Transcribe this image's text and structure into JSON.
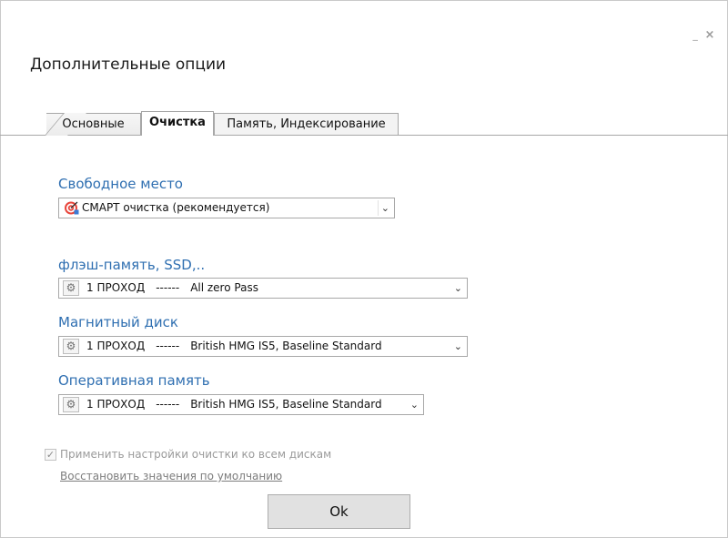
{
  "window": {
    "title": "Дополнительные опции",
    "minimize_glyph": "_",
    "close_glyph": "×"
  },
  "tabs": [
    {
      "label": "Основные",
      "active": false
    },
    {
      "label": "Очистка",
      "active": true
    },
    {
      "label": "Память, Индексирование",
      "active": false
    }
  ],
  "free_space": {
    "label": "Свободное место",
    "value": "СМАРТ очистка (рекомендуется)",
    "icon": "smart-target-icon"
  },
  "flash": {
    "label": "флэш-память, SSD,..",
    "passes": "1 ПРОХОД",
    "dashes": "------",
    "algorithm": "All zero Pass",
    "icon": "gear-icon"
  },
  "magnetic": {
    "label": "Магнитный диск",
    "passes": "1 ПРОХОД",
    "dashes": "------",
    "algorithm": "British HMG IS5, Baseline Standard",
    "icon": "gear-icon"
  },
  "ram": {
    "label": "Оперативная память",
    "passes": "1 ПРОХОД",
    "dashes": "------",
    "algorithm": "British HMG IS5, Baseline Standard",
    "icon": "gear-icon"
  },
  "apply_all": {
    "label": "Применить настройки очистки ко всем дискам",
    "checked": true
  },
  "restore_defaults": "Восстановить значения по умолчанию",
  "ok_label": "Ok",
  "colors": {
    "section_label": "#2f6fb1",
    "disabled_text": "#9a9a9a",
    "button_bg": "#e1e1e1"
  }
}
